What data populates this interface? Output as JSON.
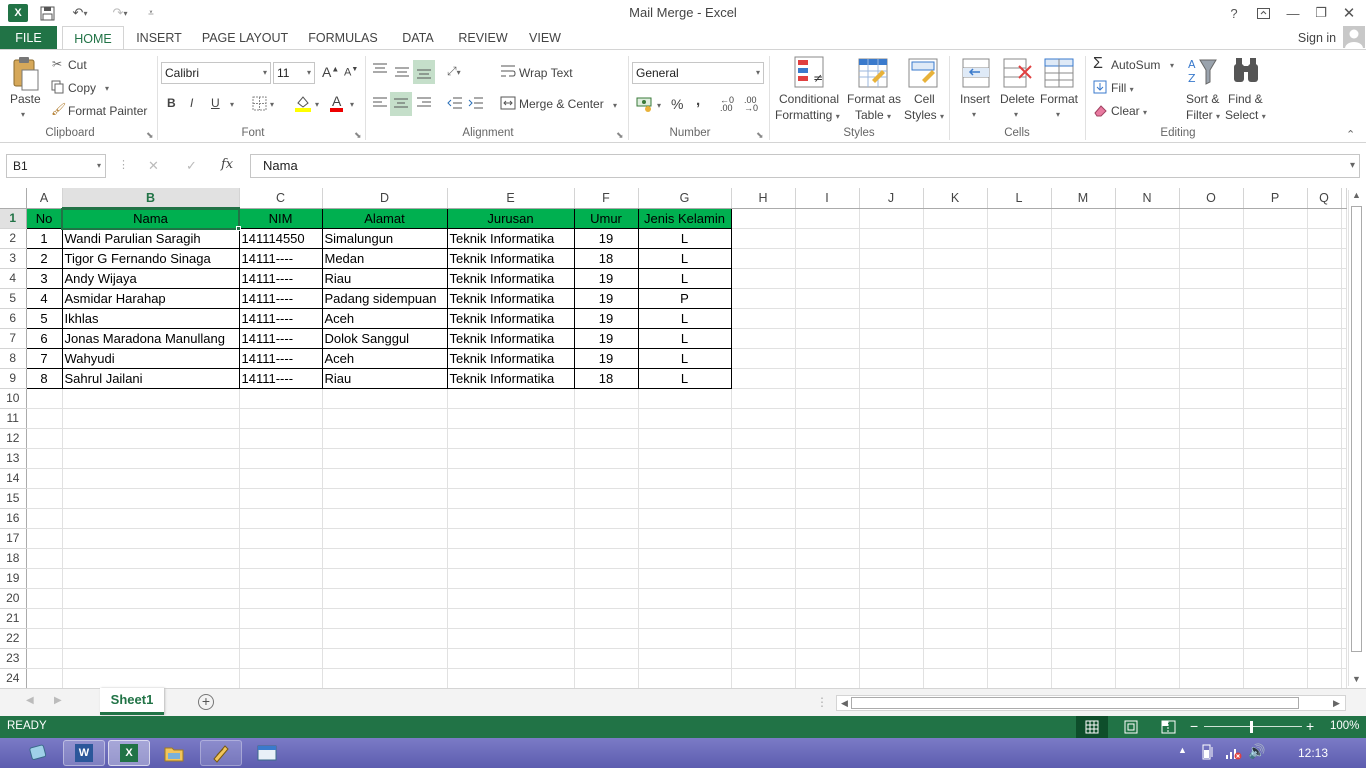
{
  "window": {
    "title": "Mail Merge - Excel",
    "help": "?"
  },
  "tabs": [
    "FILE",
    "HOME",
    "INSERT",
    "PAGE LAYOUT",
    "FORMULAS",
    "DATA",
    "REVIEW",
    "VIEW"
  ],
  "signin": "Sign in",
  "clipboard": {
    "paste": "Paste",
    "cut": "Cut",
    "copy": "Copy",
    "format_painter": "Format Painter",
    "label": "Clipboard"
  },
  "font": {
    "name": "Calibri",
    "size": "11",
    "bold": "B",
    "italic": "I",
    "underline": "U",
    "grow": "A",
    "shrink": "A",
    "color": "A",
    "label": "Font"
  },
  "alignment": {
    "wrap": "Wrap Text",
    "merge": "Merge & Center",
    "label": "Alignment"
  },
  "number": {
    "format": "General",
    "percent": "%",
    "comma": ",",
    "label": "Number"
  },
  "styles": {
    "conditional": "Conditional",
    "conditional2": "Formatting",
    "format_table": "Format as",
    "format_table2": "Table",
    "cell_styles": "Cell",
    "cell_styles2": "Styles",
    "label": "Styles"
  },
  "cells": {
    "insert": "Insert",
    "delete": "Delete",
    "format": "Format",
    "label": "Cells"
  },
  "editing": {
    "autosum": "AutoSum",
    "fill": "Fill",
    "clear": "Clear",
    "sort": "Sort &",
    "sort2": "Filter",
    "find": "Find &",
    "find2": "Select",
    "label": "Editing"
  },
  "formula_bar": {
    "name_box": "B1",
    "fx": "fx",
    "value": "Nama",
    "cancel": "✕",
    "enter": "✓"
  },
  "columns": [
    "A",
    "B",
    "C",
    "D",
    "E",
    "F",
    "G",
    "H",
    "I",
    "J",
    "K",
    "L",
    "M",
    "N",
    "O",
    "P",
    "Q"
  ],
  "table_header": [
    "No",
    "Nama",
    "NIM",
    "Alamat",
    "Jurusan",
    "Umur",
    "Jenis Kelamin"
  ],
  "rows": [
    [
      "1",
      "Wandi Parulian Saragih",
      "141114550",
      "Simalungun",
      "Teknik Informatika",
      "19",
      "L"
    ],
    [
      "2",
      "Tigor G Fernando Sinaga",
      "14111----",
      "Medan",
      "Teknik Informatika",
      "18",
      "L"
    ],
    [
      "3",
      "Andy Wijaya",
      "14111----",
      "Riau",
      "Teknik Informatika",
      "19",
      "L"
    ],
    [
      "4",
      "Asmidar Harahap",
      "14111----",
      "Padang sidempuan",
      "Teknik Informatika",
      "19",
      "P"
    ],
    [
      "5",
      "Ikhlas",
      "14111----",
      "Aceh",
      "Teknik Informatika",
      "19",
      "L"
    ],
    [
      "6",
      "Jonas Maradona Manullang",
      "14111----",
      "Dolok Sanggul",
      "Teknik Informatika",
      "19",
      "L"
    ],
    [
      "7",
      "Wahyudi",
      "14111----",
      "Aceh",
      "Teknik Informatika",
      "19",
      "L"
    ],
    [
      "8",
      "Sahrul Jailani",
      "14111----",
      "Riau",
      "Teknik Informatika",
      "18",
      "L"
    ]
  ],
  "row_numbers": [
    "1",
    "2",
    "3",
    "4",
    "5",
    "6",
    "7",
    "8",
    "9",
    "10",
    "11",
    "12",
    "13",
    "14",
    "15",
    "16",
    "17",
    "18",
    "19",
    "20",
    "21",
    "22",
    "23",
    "24"
  ],
  "sheet": {
    "name": "Sheet1",
    "add": "+"
  },
  "status": {
    "ready": "READY",
    "zoom": "100%"
  },
  "taskbar": {
    "clock": "12:13"
  },
  "colors": {
    "accent": "#217346",
    "header_fill": "#00b050",
    "taskbar": "#6a6ab8"
  }
}
